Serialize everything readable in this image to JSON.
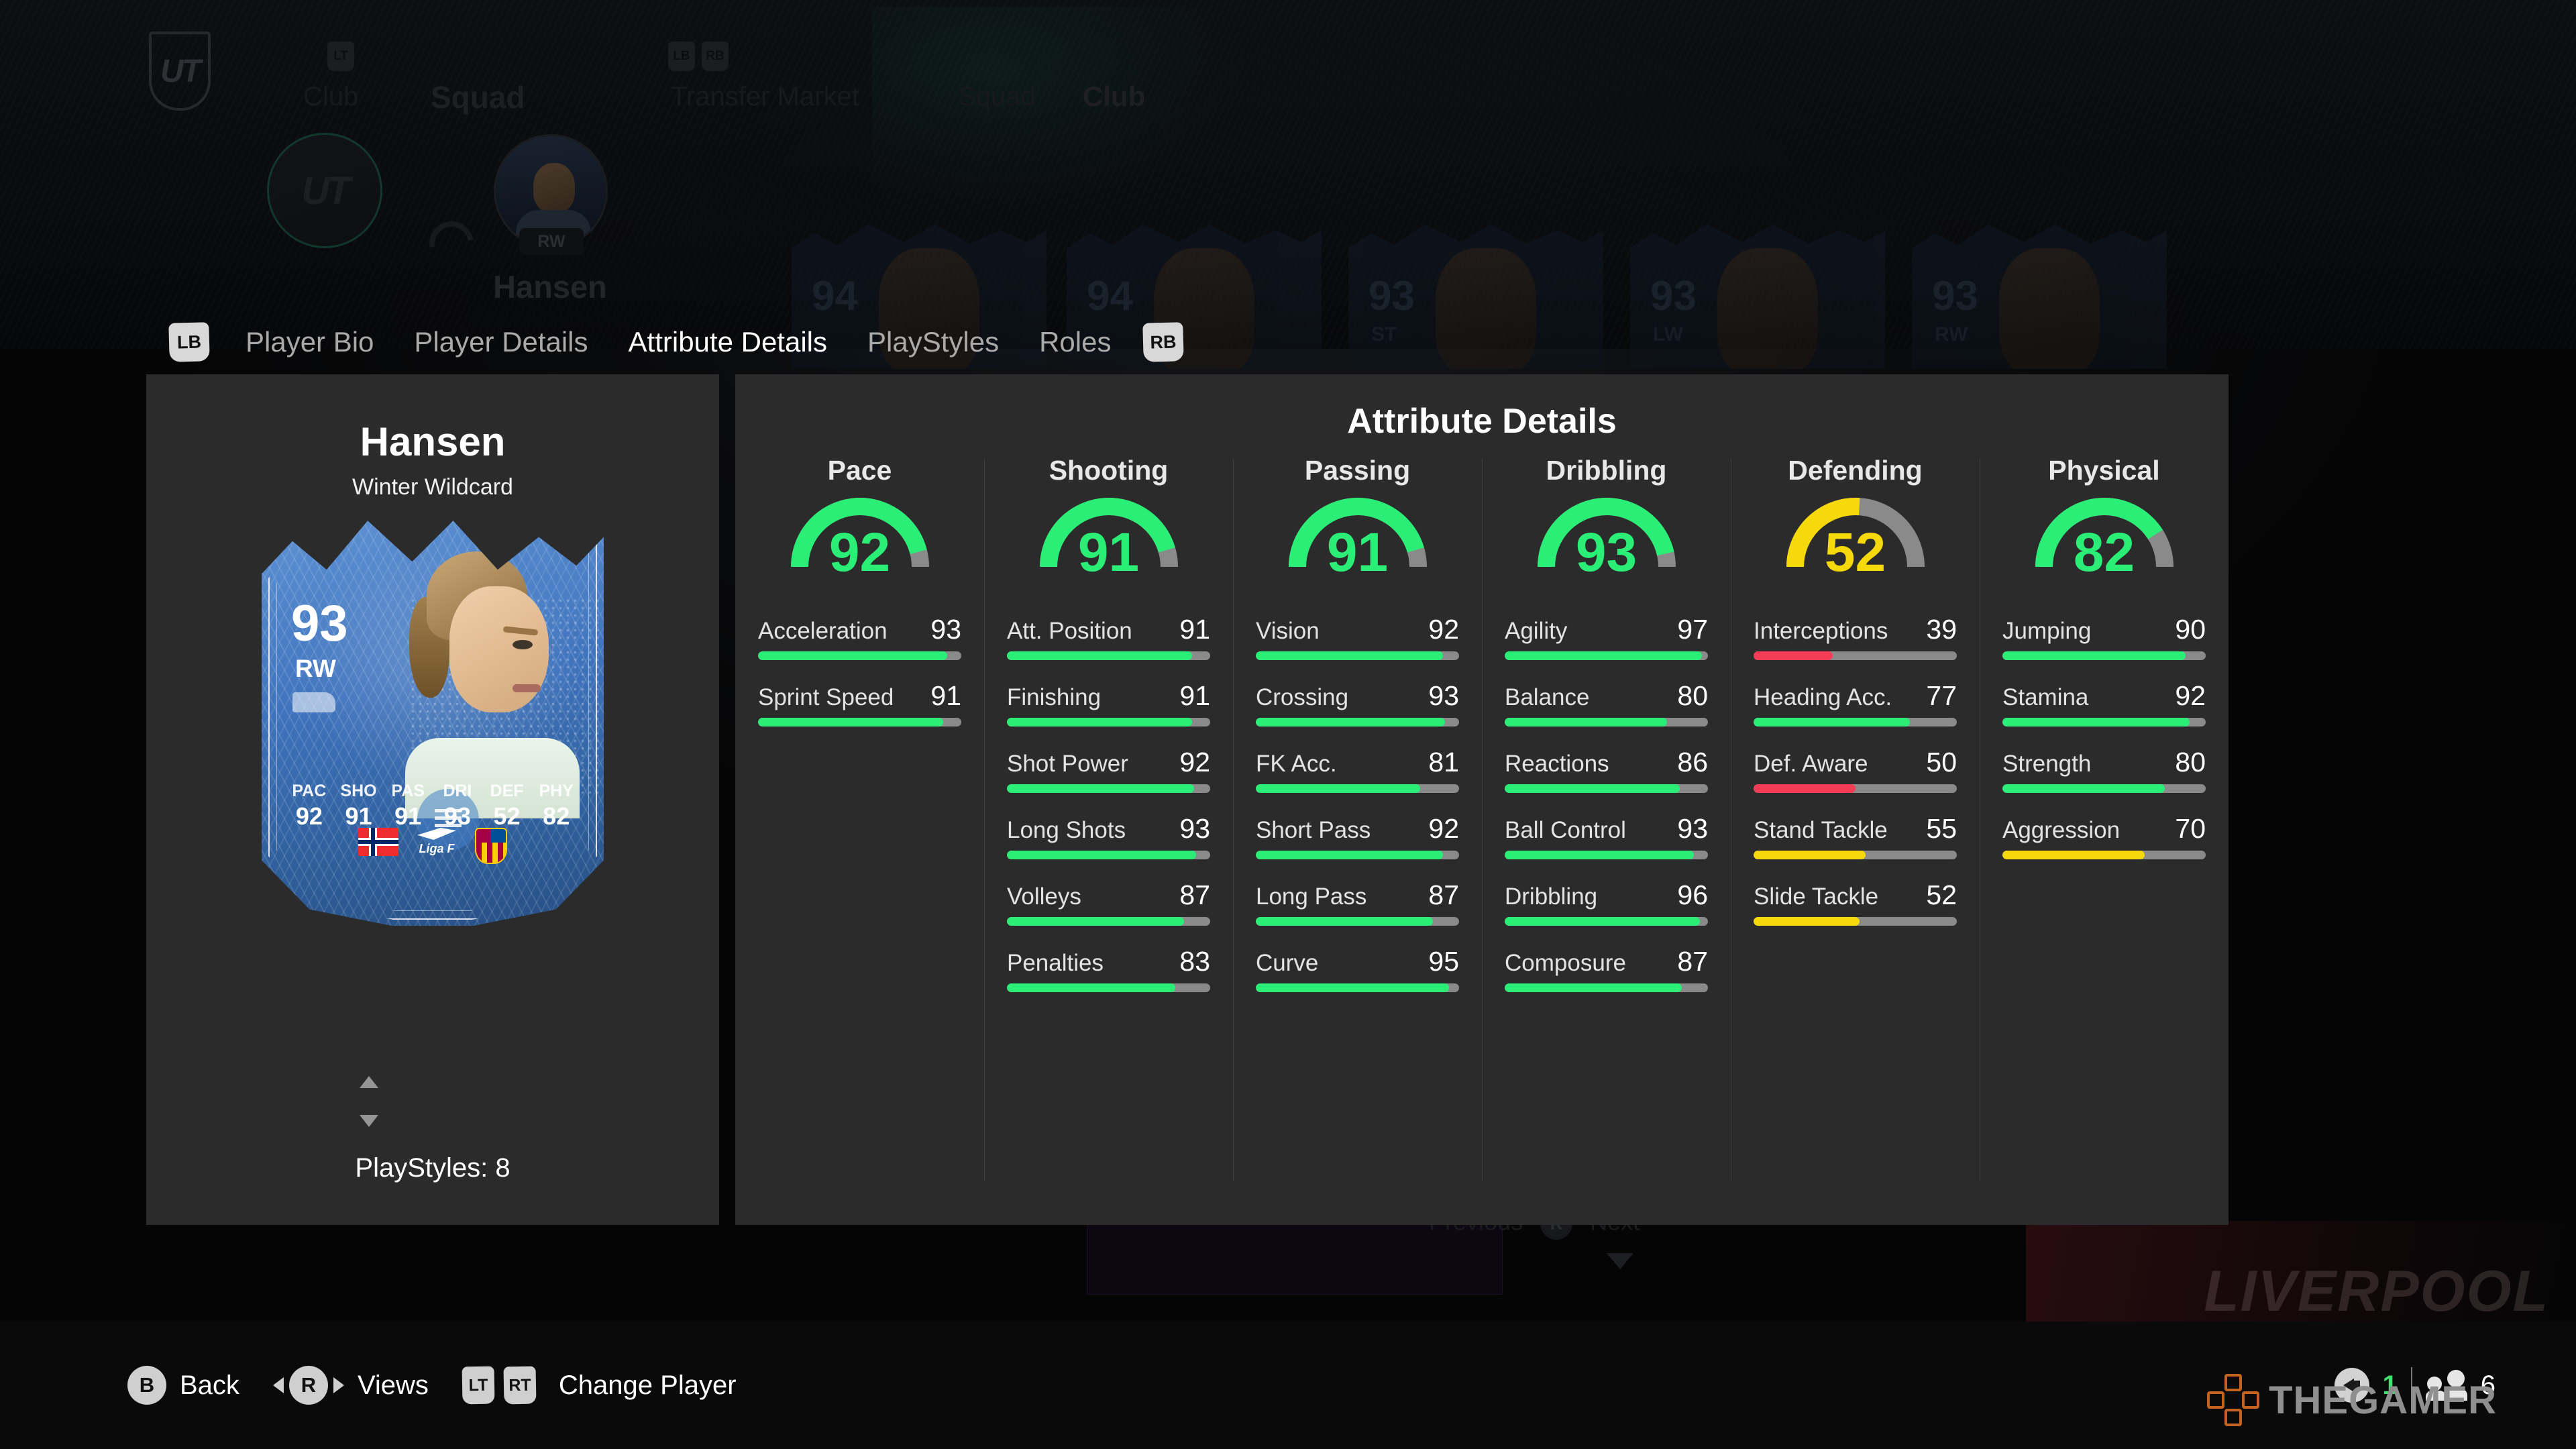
{
  "background": {
    "nav": {
      "logo": "UT",
      "left_items": [
        "Club",
        "Squad"
      ],
      "right_items": [
        "Transfer Market",
        "Squad",
        "Club"
      ],
      "bumper_lt": "LT",
      "bumper_lb": "LB",
      "bumper_rb": "RB"
    },
    "swap": {
      "left_avatar_label": "UT",
      "right_player_name": "Hansen",
      "right_player_position": "RW"
    },
    "squad_cards": [
      {
        "rating": "94",
        "position": ""
      },
      {
        "rating": "94",
        "position": ""
      },
      {
        "rating": "93",
        "position": "ST"
      },
      {
        "rating": "93",
        "position": "LW"
      },
      {
        "rating": "93",
        "position": "RW"
      }
    ],
    "pager": {
      "previous": "Previous",
      "button": "R",
      "next": "Next"
    },
    "banner_text": "LIVERPOOL"
  },
  "tabs": {
    "bumper_left": "LB",
    "bumper_right": "RB",
    "items": [
      {
        "label": "Player Bio",
        "active": false
      },
      {
        "label": "Player Details",
        "active": false
      },
      {
        "label": "Attribute Details",
        "active": true
      },
      {
        "label": "PlayStyles",
        "active": false
      },
      {
        "label": "Roles",
        "active": false
      }
    ]
  },
  "player": {
    "name": "Hansen",
    "card_type": "Winter Wildcard",
    "card": {
      "rating": "93",
      "position": "RW",
      "stat_labels": [
        "PAC",
        "SHO",
        "PAS",
        "DRI",
        "DEF",
        "PHY"
      ],
      "stat_values": [
        "92",
        "91",
        "91",
        "93",
        "52",
        "82"
      ],
      "nation": "Norway",
      "league": "Liga F",
      "club": "FCB"
    },
    "playstyles_label": "PlayStyles: 8"
  },
  "panel": {
    "title": "Attribute Details"
  },
  "colors": {
    "green": "#2BEE77",
    "yellow": "#F5D90A",
    "red": "#F43C56",
    "track": "#8A8A8A",
    "panel_bg": "#2B2B2B"
  },
  "chart_data": {
    "type": "bar",
    "title": "Attribute Details",
    "ylim": [
      0,
      100
    ],
    "grid": false,
    "legend": "none",
    "groups": [
      {
        "name": "Pace",
        "overall": 92,
        "overall_color": "#2BEE77",
        "categories": [
          "Acceleration",
          "Sprint Speed"
        ],
        "values": [
          93,
          91
        ],
        "bar_colors": [
          "#2BEE77",
          "#2BEE77"
        ]
      },
      {
        "name": "Shooting",
        "overall": 91,
        "overall_color": "#2BEE77",
        "categories": [
          "Att. Position",
          "Finishing",
          "Shot Power",
          "Long Shots",
          "Volleys",
          "Penalties"
        ],
        "values": [
          91,
          91,
          92,
          93,
          87,
          83
        ],
        "bar_colors": [
          "#2BEE77",
          "#2BEE77",
          "#2BEE77",
          "#2BEE77",
          "#2BEE77",
          "#2BEE77"
        ]
      },
      {
        "name": "Passing",
        "overall": 91,
        "overall_color": "#2BEE77",
        "categories": [
          "Vision",
          "Crossing",
          "FK Acc.",
          "Short Pass",
          "Long Pass",
          "Curve"
        ],
        "values": [
          92,
          93,
          81,
          92,
          87,
          95
        ],
        "bar_colors": [
          "#2BEE77",
          "#2BEE77",
          "#2BEE77",
          "#2BEE77",
          "#2BEE77",
          "#2BEE77"
        ]
      },
      {
        "name": "Dribbling",
        "overall": 93,
        "overall_color": "#2BEE77",
        "categories": [
          "Agility",
          "Balance",
          "Reactions",
          "Ball Control",
          "Dribbling",
          "Composure"
        ],
        "values": [
          97,
          80,
          86,
          93,
          96,
          87
        ],
        "bar_colors": [
          "#2BEE77",
          "#2BEE77",
          "#2BEE77",
          "#2BEE77",
          "#2BEE77",
          "#2BEE77"
        ]
      },
      {
        "name": "Defending",
        "overall": 52,
        "overall_color": "#F5D90A",
        "categories": [
          "Interceptions",
          "Heading Acc.",
          "Def. Aware",
          "Stand Tackle",
          "Slide Tackle"
        ],
        "values": [
          39,
          77,
          50,
          55,
          52
        ],
        "bar_colors": [
          "#F43C56",
          "#2BEE77",
          "#F43C56",
          "#F5D90A",
          "#F5D90A"
        ]
      },
      {
        "name": "Physical",
        "overall": 82,
        "overall_color": "#2BEE77",
        "categories": [
          "Jumping",
          "Stamina",
          "Strength",
          "Aggression"
        ],
        "values": [
          90,
          92,
          80,
          70
        ],
        "bar_colors": [
          "#2BEE77",
          "#2BEE77",
          "#2BEE77",
          "#F5D90A"
        ]
      }
    ]
  },
  "bottombar": {
    "actions": [
      {
        "button": "B",
        "label": "Back"
      },
      {
        "button": "R",
        "label": "Views"
      }
    ],
    "change_player": {
      "lt": "LT",
      "rt": "RT",
      "label": "Change Player"
    },
    "status": {
      "volume": "1",
      "friends": "6"
    },
    "watermark": "THEGAMER"
  }
}
